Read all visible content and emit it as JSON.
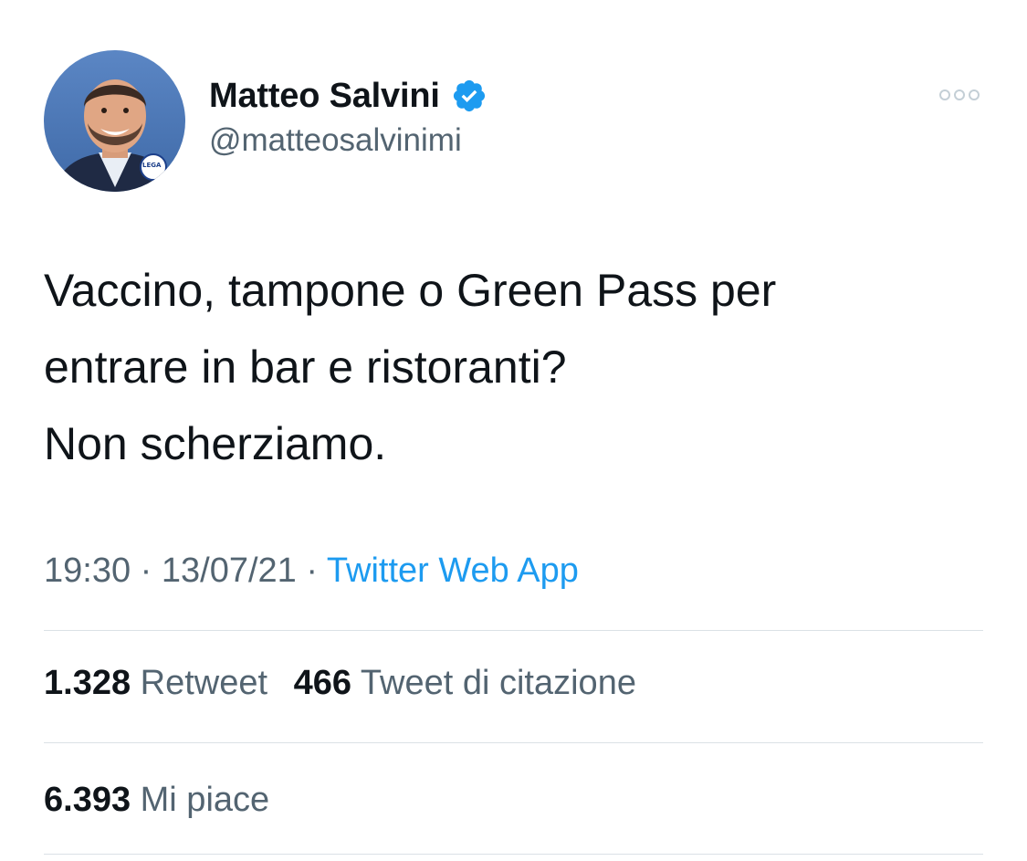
{
  "author": {
    "display_name": "Matteo Salvini",
    "handle": "@matteosalvinimi",
    "verified": true,
    "avatar_badge_text": "LEGA"
  },
  "icons": {
    "verified": "verified-badge-icon",
    "more": "more-horizontal-icon"
  },
  "tweet": {
    "text": "Vaccino, tampone o Green Pass per\nentrare in bar e ristoranti?\nNon scherziamo.",
    "time": "19:30",
    "separator": "·",
    "date": "13/07/21",
    "source": "Twitter Web App"
  },
  "stats": {
    "retweets": {
      "count": "1.328",
      "label": "Retweet"
    },
    "quotes": {
      "count": "466",
      "label": "Tweet di citazione"
    },
    "likes": {
      "count": "6.393",
      "label": "Mi piace"
    }
  },
  "colors": {
    "accent": "#1d9bf0",
    "text_primary": "#0f1419",
    "text_secondary": "#536471",
    "divider": "#dbe1e6"
  }
}
